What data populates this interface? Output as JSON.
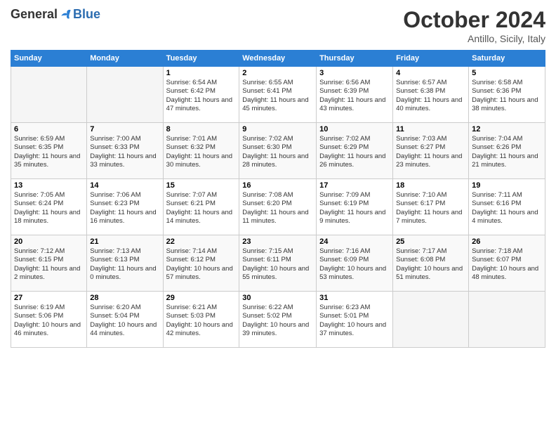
{
  "header": {
    "logo_general": "General",
    "logo_blue": "Blue",
    "month": "October 2024",
    "location": "Antillo, Sicily, Italy"
  },
  "days_of_week": [
    "Sunday",
    "Monday",
    "Tuesday",
    "Wednesday",
    "Thursday",
    "Friday",
    "Saturday"
  ],
  "weeks": [
    [
      {
        "day": "",
        "info": ""
      },
      {
        "day": "",
        "info": ""
      },
      {
        "day": "1",
        "info": "Sunrise: 6:54 AM\nSunset: 6:42 PM\nDaylight: 11 hours and 47 minutes."
      },
      {
        "day": "2",
        "info": "Sunrise: 6:55 AM\nSunset: 6:41 PM\nDaylight: 11 hours and 45 minutes."
      },
      {
        "day": "3",
        "info": "Sunrise: 6:56 AM\nSunset: 6:39 PM\nDaylight: 11 hours and 43 minutes."
      },
      {
        "day": "4",
        "info": "Sunrise: 6:57 AM\nSunset: 6:38 PM\nDaylight: 11 hours and 40 minutes."
      },
      {
        "day": "5",
        "info": "Sunrise: 6:58 AM\nSunset: 6:36 PM\nDaylight: 11 hours and 38 minutes."
      }
    ],
    [
      {
        "day": "6",
        "info": "Sunrise: 6:59 AM\nSunset: 6:35 PM\nDaylight: 11 hours and 35 minutes."
      },
      {
        "day": "7",
        "info": "Sunrise: 7:00 AM\nSunset: 6:33 PM\nDaylight: 11 hours and 33 minutes."
      },
      {
        "day": "8",
        "info": "Sunrise: 7:01 AM\nSunset: 6:32 PM\nDaylight: 11 hours and 30 minutes."
      },
      {
        "day": "9",
        "info": "Sunrise: 7:02 AM\nSunset: 6:30 PM\nDaylight: 11 hours and 28 minutes."
      },
      {
        "day": "10",
        "info": "Sunrise: 7:02 AM\nSunset: 6:29 PM\nDaylight: 11 hours and 26 minutes."
      },
      {
        "day": "11",
        "info": "Sunrise: 7:03 AM\nSunset: 6:27 PM\nDaylight: 11 hours and 23 minutes."
      },
      {
        "day": "12",
        "info": "Sunrise: 7:04 AM\nSunset: 6:26 PM\nDaylight: 11 hours and 21 minutes."
      }
    ],
    [
      {
        "day": "13",
        "info": "Sunrise: 7:05 AM\nSunset: 6:24 PM\nDaylight: 11 hours and 18 minutes."
      },
      {
        "day": "14",
        "info": "Sunrise: 7:06 AM\nSunset: 6:23 PM\nDaylight: 11 hours and 16 minutes."
      },
      {
        "day": "15",
        "info": "Sunrise: 7:07 AM\nSunset: 6:21 PM\nDaylight: 11 hours and 14 minutes."
      },
      {
        "day": "16",
        "info": "Sunrise: 7:08 AM\nSunset: 6:20 PM\nDaylight: 11 hours and 11 minutes."
      },
      {
        "day": "17",
        "info": "Sunrise: 7:09 AM\nSunset: 6:19 PM\nDaylight: 11 hours and 9 minutes."
      },
      {
        "day": "18",
        "info": "Sunrise: 7:10 AM\nSunset: 6:17 PM\nDaylight: 11 hours and 7 minutes."
      },
      {
        "day": "19",
        "info": "Sunrise: 7:11 AM\nSunset: 6:16 PM\nDaylight: 11 hours and 4 minutes."
      }
    ],
    [
      {
        "day": "20",
        "info": "Sunrise: 7:12 AM\nSunset: 6:15 PM\nDaylight: 11 hours and 2 minutes."
      },
      {
        "day": "21",
        "info": "Sunrise: 7:13 AM\nSunset: 6:13 PM\nDaylight: 11 hours and 0 minutes."
      },
      {
        "day": "22",
        "info": "Sunrise: 7:14 AM\nSunset: 6:12 PM\nDaylight: 10 hours and 57 minutes."
      },
      {
        "day": "23",
        "info": "Sunrise: 7:15 AM\nSunset: 6:11 PM\nDaylight: 10 hours and 55 minutes."
      },
      {
        "day": "24",
        "info": "Sunrise: 7:16 AM\nSunset: 6:09 PM\nDaylight: 10 hours and 53 minutes."
      },
      {
        "day": "25",
        "info": "Sunrise: 7:17 AM\nSunset: 6:08 PM\nDaylight: 10 hours and 51 minutes."
      },
      {
        "day": "26",
        "info": "Sunrise: 7:18 AM\nSunset: 6:07 PM\nDaylight: 10 hours and 48 minutes."
      }
    ],
    [
      {
        "day": "27",
        "info": "Sunrise: 6:19 AM\nSunset: 5:06 PM\nDaylight: 10 hours and 46 minutes."
      },
      {
        "day": "28",
        "info": "Sunrise: 6:20 AM\nSunset: 5:04 PM\nDaylight: 10 hours and 44 minutes."
      },
      {
        "day": "29",
        "info": "Sunrise: 6:21 AM\nSunset: 5:03 PM\nDaylight: 10 hours and 42 minutes."
      },
      {
        "day": "30",
        "info": "Sunrise: 6:22 AM\nSunset: 5:02 PM\nDaylight: 10 hours and 39 minutes."
      },
      {
        "day": "31",
        "info": "Sunrise: 6:23 AM\nSunset: 5:01 PM\nDaylight: 10 hours and 37 minutes."
      },
      {
        "day": "",
        "info": ""
      },
      {
        "day": "",
        "info": ""
      }
    ]
  ]
}
